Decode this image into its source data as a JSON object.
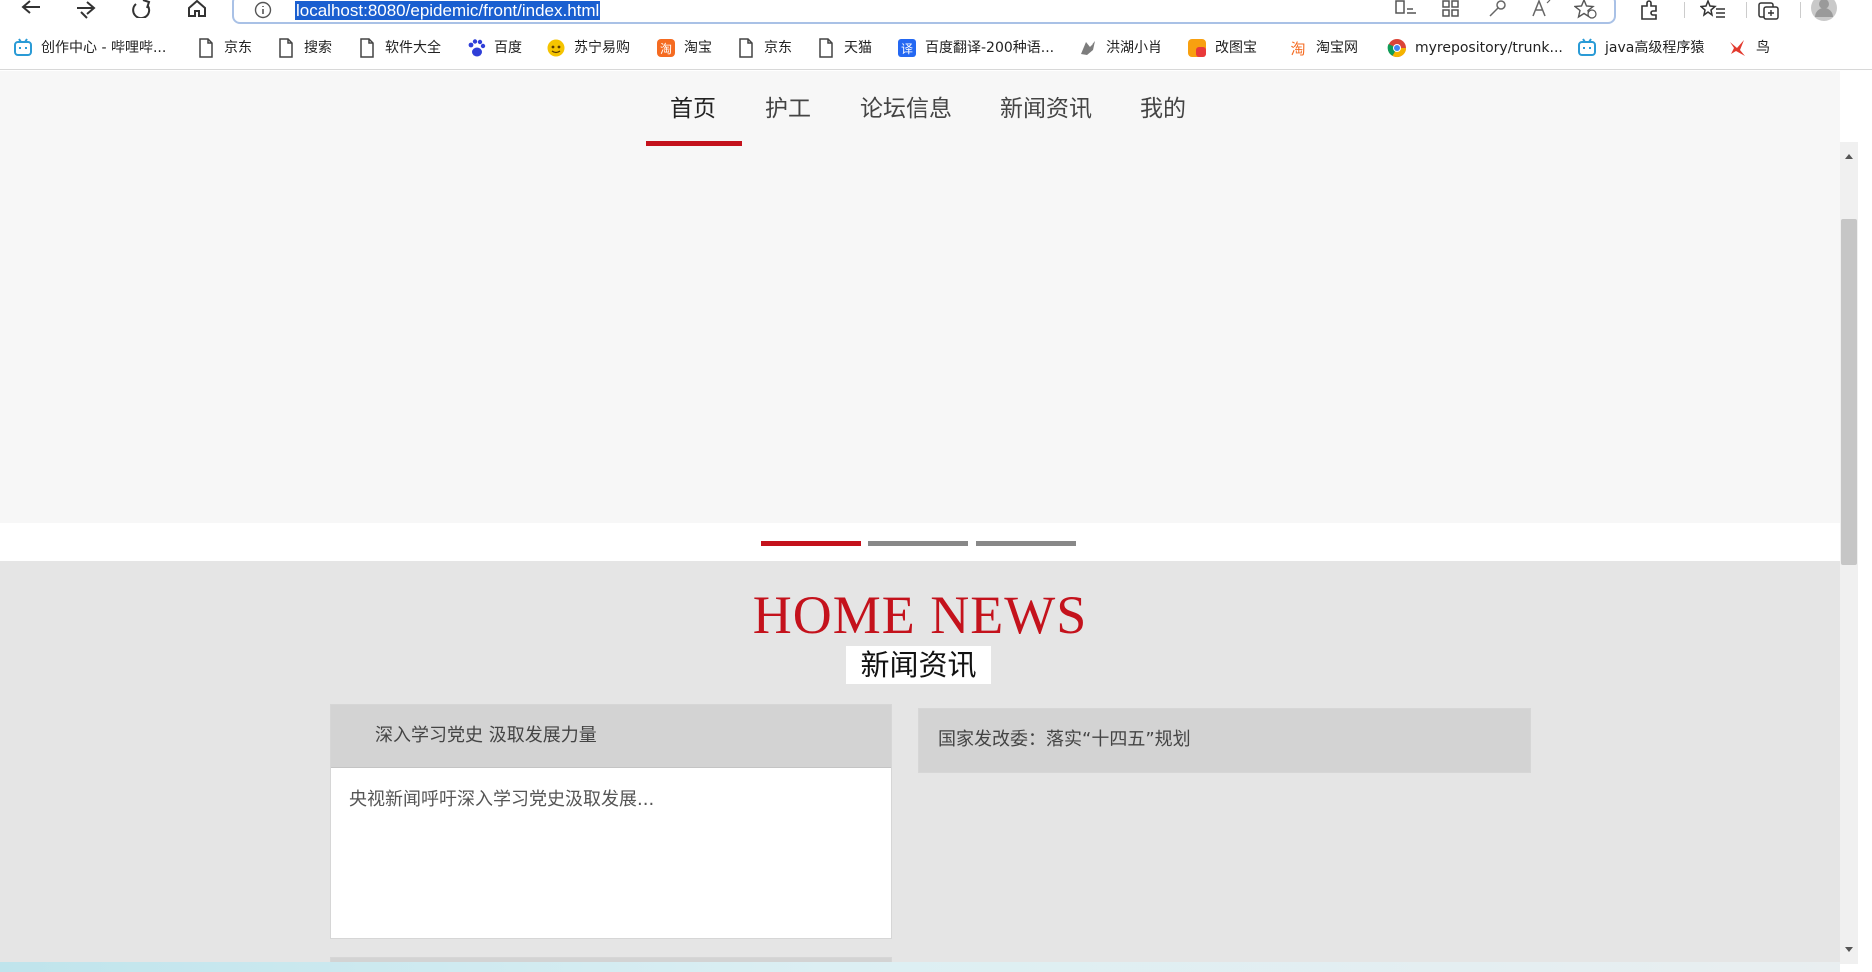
{
  "browser": {
    "url": "localhost:8080/epidemic/front/index.html",
    "icons": {
      "back": "arrow-left-icon",
      "forward": "arrow-right-icon",
      "reload": "reload-icon",
      "home": "home-icon",
      "site_info": "info-icon",
      "read_aloud": "read-aloud-icon",
      "apps": "apps-icon",
      "key": "key-icon",
      "font": "font-icon",
      "favorite": "star-add-icon",
      "extensions": "puzzle-icon",
      "favorites": "favorites-icon",
      "collections": "collections-icon",
      "profile": "profile-icon"
    }
  },
  "bookmarks": [
    {
      "label": "创作中心 - 哔哩哔...",
      "icon": "bilibili-icon"
    },
    {
      "label": "京东",
      "icon": "page-icon"
    },
    {
      "label": "搜索",
      "icon": "page-icon"
    },
    {
      "label": "软件大全",
      "icon": "page-icon"
    },
    {
      "label": "百度",
      "icon": "baidu-paw-icon"
    },
    {
      "label": "苏宁易购",
      "icon": "suning-icon"
    },
    {
      "label": "淘宝",
      "icon": "taobao-icon"
    },
    {
      "label": "京东",
      "icon": "page-icon"
    },
    {
      "label": "天猫",
      "icon": "page-icon"
    },
    {
      "label": "百度翻译-200种语...",
      "icon": "translate-icon"
    },
    {
      "label": "洪湖小肖",
      "icon": "gray-figure-icon"
    },
    {
      "label": "改图宝",
      "icon": "gaitubao-icon"
    },
    {
      "label": "淘宝网",
      "icon": "taobao-orange-icon"
    },
    {
      "label": "myrepository/trunk...",
      "icon": "chrome-icon"
    },
    {
      "label": "java高级程序猿",
      "icon": "bilibili-icon"
    },
    {
      "label": "鸟",
      "icon": "bird-icon"
    }
  ],
  "nav": {
    "items": [
      {
        "label": "首页",
        "active": true
      },
      {
        "label": "护工",
        "active": false
      },
      {
        "label": "论坛信息",
        "active": false
      },
      {
        "label": "新闻资讯",
        "active": false
      },
      {
        "label": "我的",
        "active": false
      }
    ],
    "accent": "#c4121c"
  },
  "carousel": {
    "slide_count": 3,
    "active_index": 0,
    "active_color": "#c4121c",
    "inactive_color": "#888888"
  },
  "news": {
    "heading_en": "HOME NEWS",
    "heading_cn": "新闻资讯",
    "heading_color": "#c4121c",
    "cards": [
      {
        "title": "深入学习党史 汲取发展力量",
        "summary": "央视新闻呼吁深入学习党史汲取发展..."
      },
      {
        "title": "国家发改委：落实“十四五”规划",
        "summary": ""
      }
    ]
  }
}
